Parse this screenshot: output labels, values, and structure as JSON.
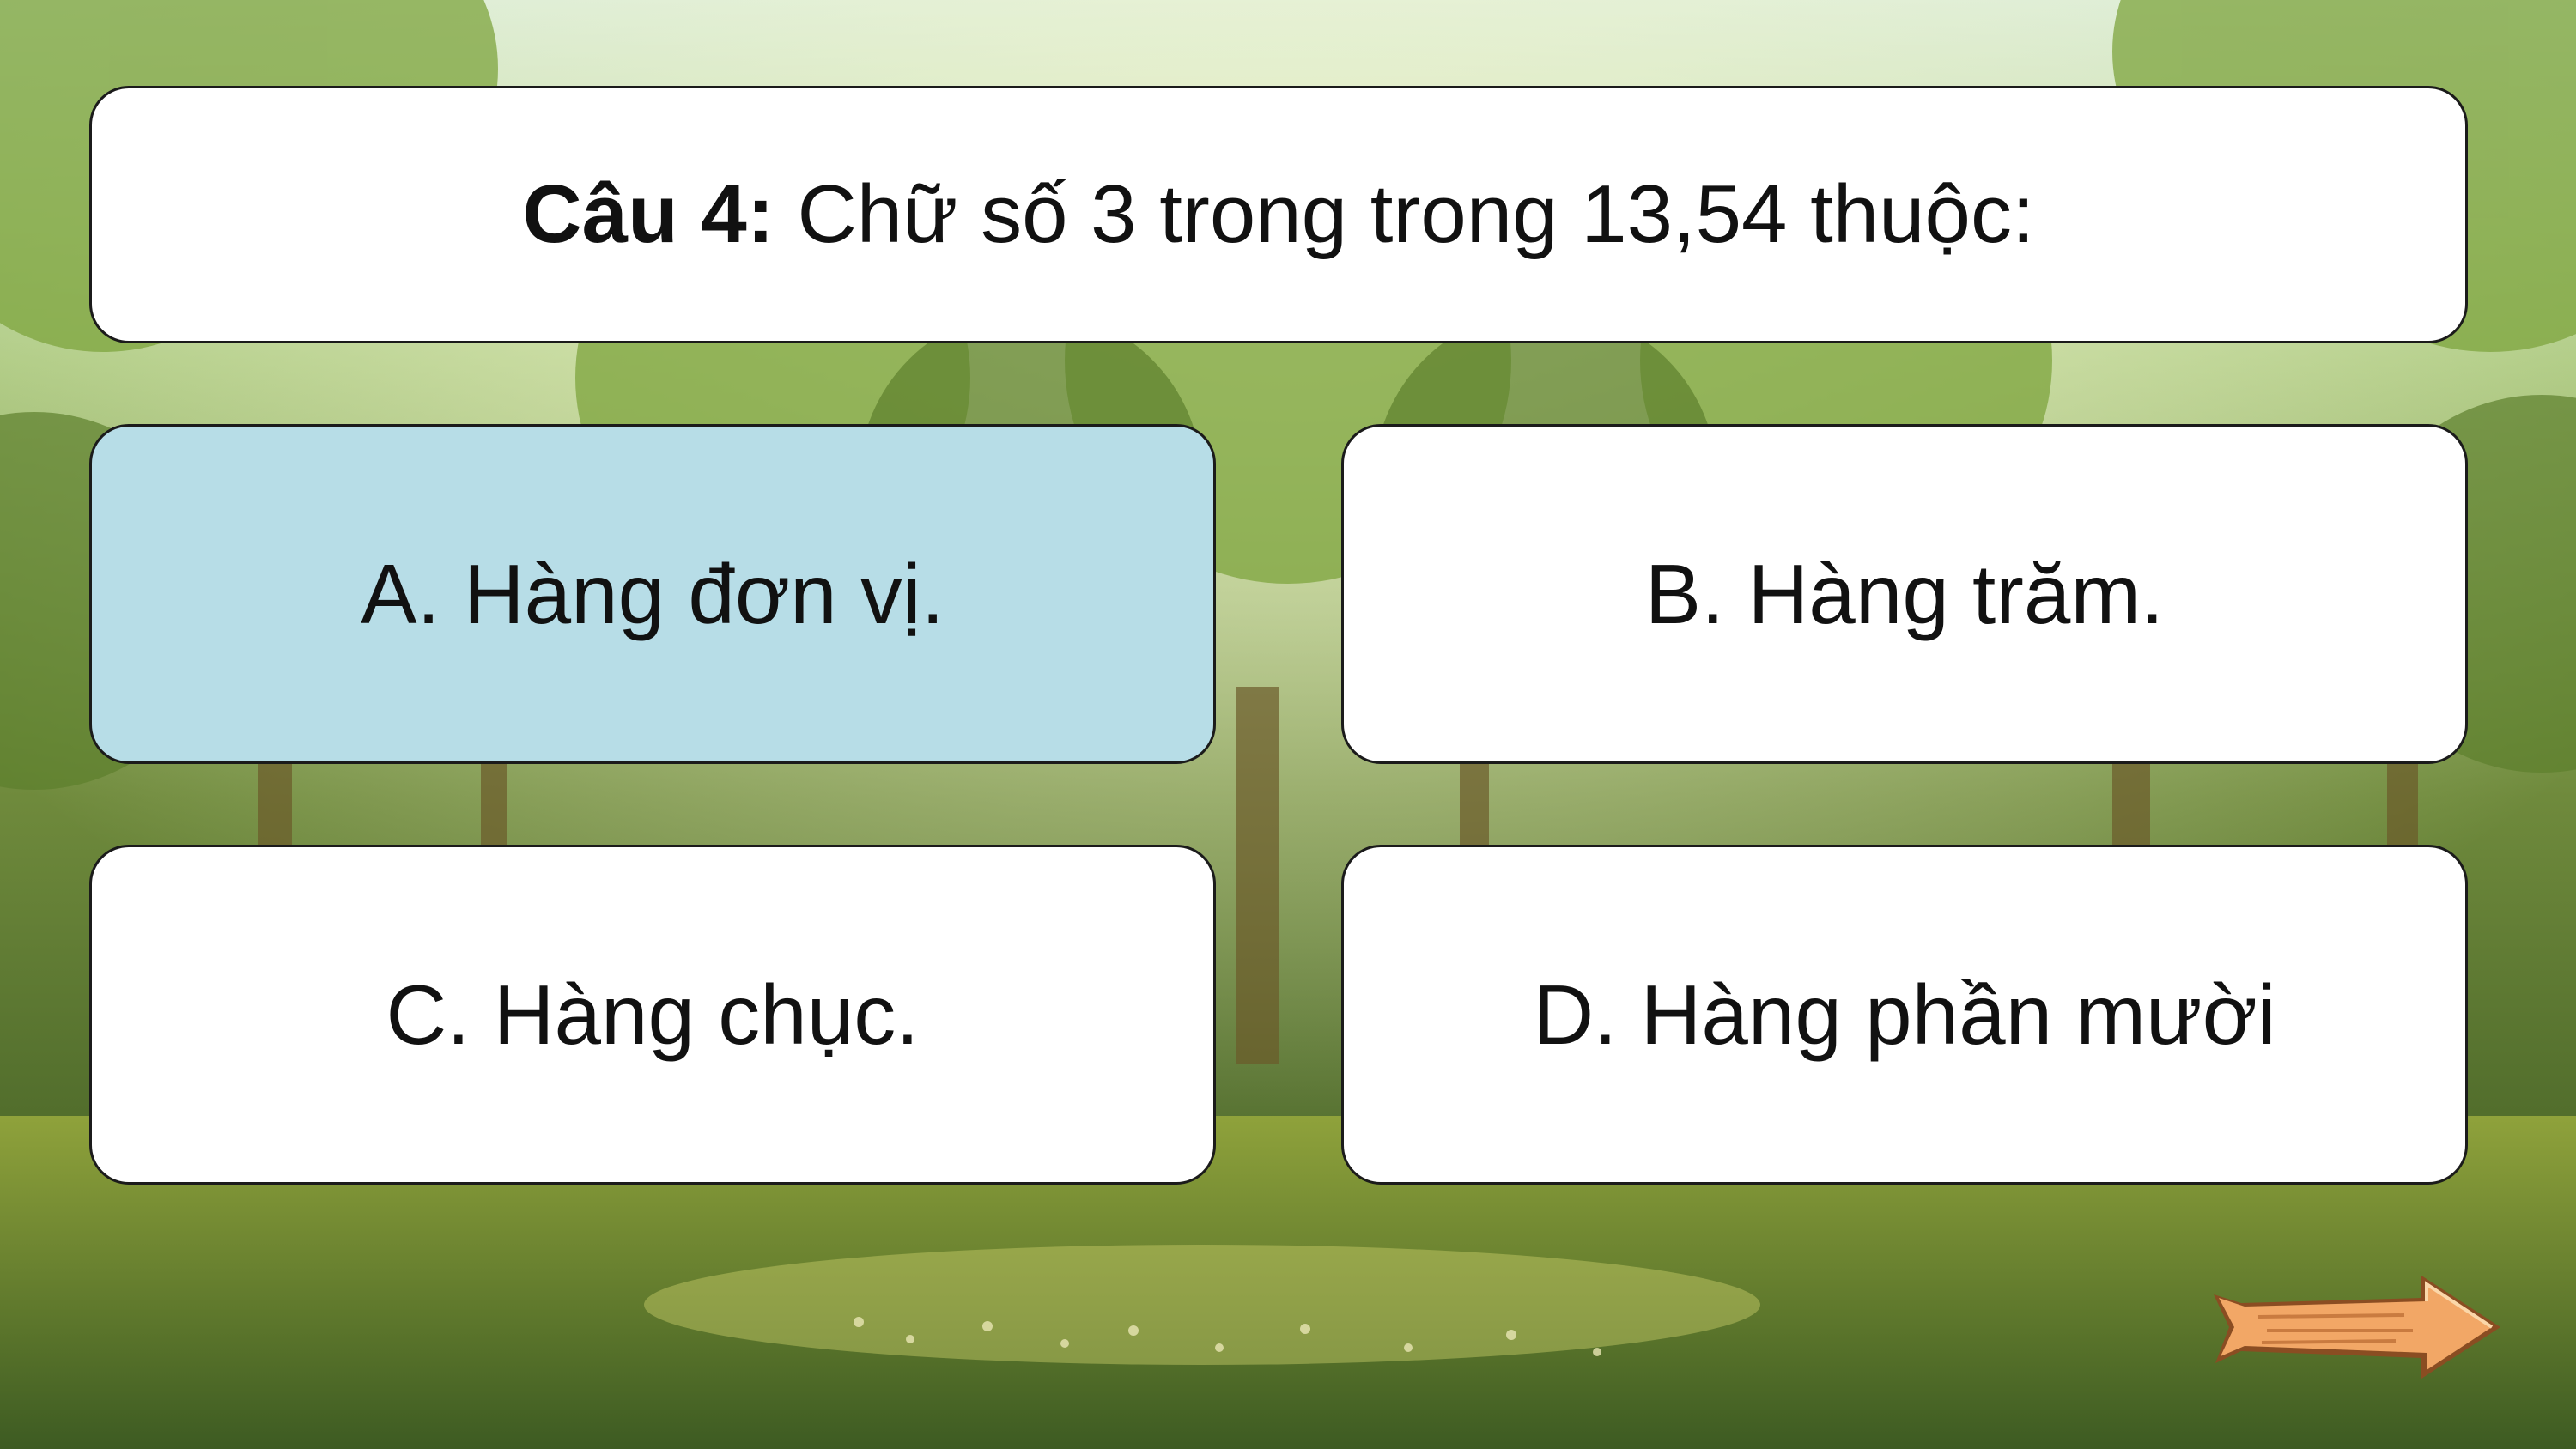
{
  "question": {
    "label": "Câu 4:",
    "text": " Chữ số 3 trong trong 13,54 thuộc:"
  },
  "answers": [
    {
      "text": "A. Hàng đơn vị.",
      "highlighted": true
    },
    {
      "text": "B. Hàng trăm.",
      "highlighted": false
    },
    {
      "text": "C. Hàng chục.",
      "highlighted": false
    },
    {
      "text": "D. Hàng phần mười",
      "highlighted": false
    }
  ],
  "colors": {
    "highlight": "#b7dde7",
    "card": "#ffffff",
    "border": "#1b1b1b",
    "arrow": "#f2a766"
  },
  "icons": {
    "next": "wooden-arrow-right-icon"
  }
}
